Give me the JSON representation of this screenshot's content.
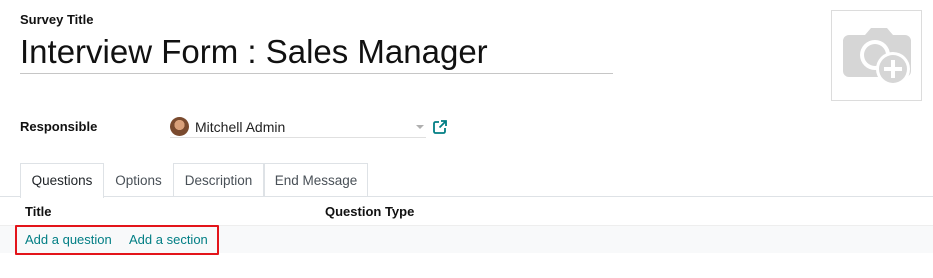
{
  "form": {
    "survey_title_label": "Survey Title",
    "survey_title_value": "Interview Form : Sales Manager",
    "responsible_label": "Responsible",
    "responsible_value": "Mitchell Admin"
  },
  "image": {
    "icon": "camera-plus-icon"
  },
  "tabs": [
    {
      "label": "Questions",
      "active": true
    },
    {
      "label": "Options",
      "active": false
    },
    {
      "label": "Description",
      "active": false
    },
    {
      "label": "End Message",
      "active": false
    }
  ],
  "questions_list": {
    "columns": [
      "Title",
      "Question Type"
    ],
    "add_question_label": "Add a question",
    "add_section_label": "Add a section"
  },
  "colors": {
    "link": "#017e84",
    "highlight": "#e3141a",
    "text": "#212529"
  }
}
